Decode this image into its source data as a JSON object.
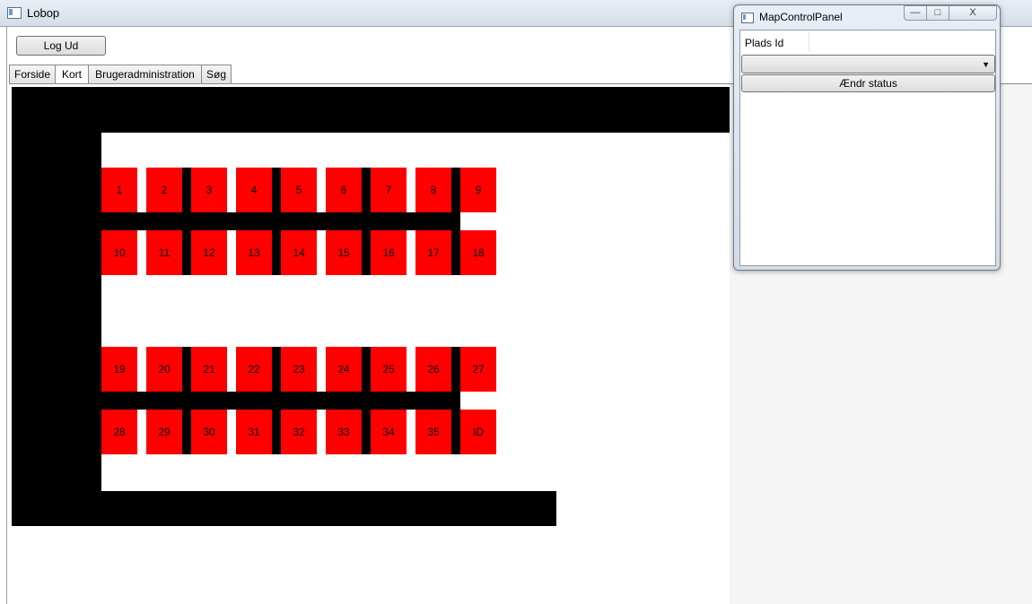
{
  "window": {
    "title": "Lobop"
  },
  "toolbar": {
    "logout_label": "Log Ud"
  },
  "tabs": [
    {
      "label": "Forside",
      "selected": false
    },
    {
      "label": "Kort",
      "selected": true
    },
    {
      "label": "Brugeradministration",
      "selected": false
    },
    {
      "label": "Søg",
      "selected": false
    }
  ],
  "map": {
    "spot_color": "#ff0000",
    "wall_color": "#000000",
    "rows": [
      [
        "1",
        "2",
        "3",
        "4",
        "5",
        "6",
        "7",
        "8",
        "9"
      ],
      [
        "10",
        "11",
        "12",
        "13",
        "14",
        "15",
        "16",
        "17",
        "18"
      ],
      [
        "19",
        "20",
        "21",
        "22",
        "23",
        "24",
        "25",
        "26",
        "27"
      ],
      [
        "28",
        "29",
        "30",
        "31",
        "32",
        "33",
        "34",
        "35",
        "ID"
      ]
    ]
  },
  "control_panel": {
    "title": "MapControlPanel",
    "plads_label": "Plads Id",
    "plads_value": "",
    "status_selected": "",
    "change_status_label": "Ændr status",
    "window_buttons": {
      "minimize": "—",
      "maximize": "□",
      "close": "X"
    }
  },
  "icons": {
    "app": "window-icon",
    "dropdown": "chevron-down-icon"
  }
}
